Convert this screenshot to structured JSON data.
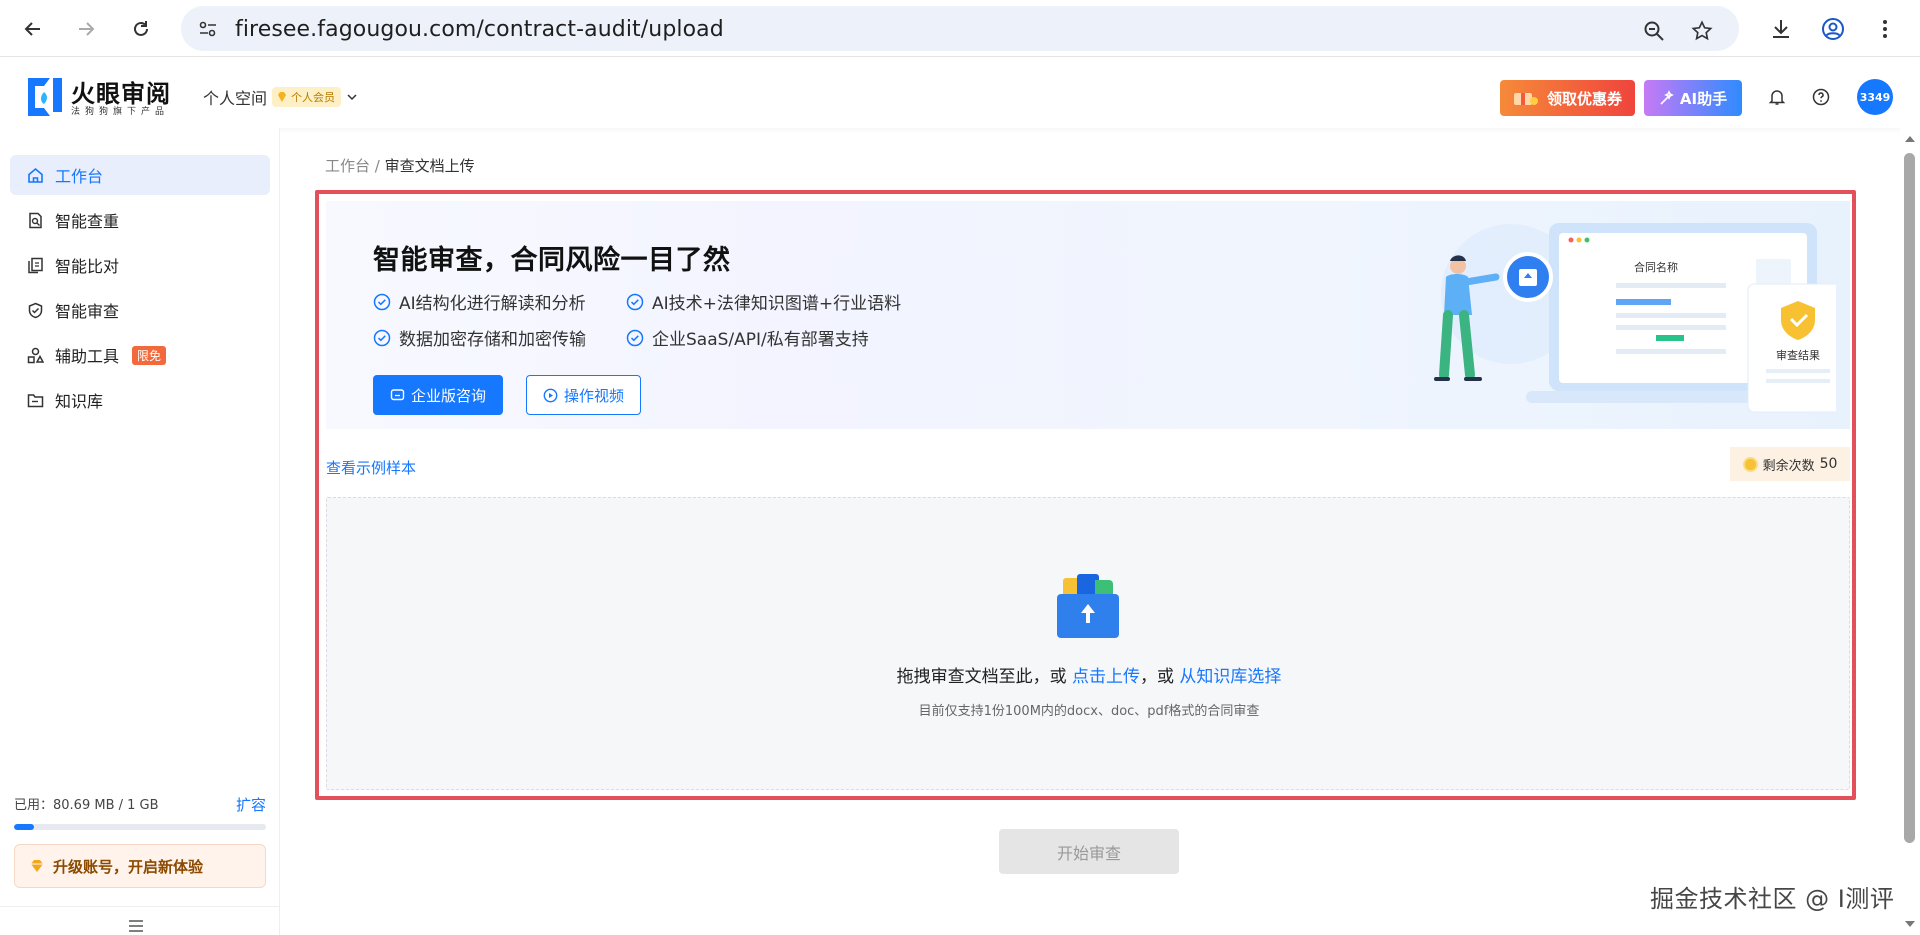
{
  "browser": {
    "url": "firesee.fagougou.com/contract-audit/upload"
  },
  "header": {
    "logo_title": "火眼审阅",
    "logo_sub": "法狗狗旗下产品",
    "space_label": "个人空间",
    "vip_label": "个人会员",
    "coupon_label": "领取优惠券",
    "ai_label": "AI助手",
    "avatar_text": "3349"
  },
  "sidebar": {
    "items": [
      {
        "label": "工作台",
        "icon": "home-icon"
      },
      {
        "label": "智能查重",
        "icon": "doc-search-icon"
      },
      {
        "label": "智能比对",
        "icon": "compare-icon"
      },
      {
        "label": "智能审查",
        "icon": "shield-icon"
      },
      {
        "label": "辅助工具",
        "icon": "tools-icon",
        "tag": "限免"
      },
      {
        "label": "知识库",
        "icon": "folder-icon"
      }
    ],
    "storage_used": "已用：80.69 MB / 1 GB",
    "storage_fraction": 0.079,
    "expand_label": "扩容",
    "upgrade_label": "升级账号，开启新体验"
  },
  "breadcrumb": {
    "root": "工作台",
    "separator": " / ",
    "current": "审查文档上传"
  },
  "banner": {
    "title": "智能审查，合同风险一目了然",
    "features": [
      "AI结构化进行解读和分析",
      "AI技术+法律知识图谱+行业语料",
      "数据加密存储和加密传输",
      "企业SaaS/API/私有部署支持"
    ],
    "consult_label": "企业版咨询",
    "video_label": "操作视频",
    "card_title": "合同名称",
    "result_label": "审查结果"
  },
  "upload": {
    "sample_link": "查看示例样本",
    "remain_label": "剩余次数",
    "remain_count": "50",
    "drop_prefix": "拖拽审查文档至此，或 ",
    "drop_link1": "点击上传",
    "drop_middle": "，或 ",
    "drop_link2": "从知识库选择",
    "hint": "目前仅支持1份100M内的docx、doc、pdf格式的合同审查",
    "start_label": "开始审查"
  },
  "watermark": "掘金技术社区 @ I测评",
  "colors": {
    "primary": "#1677ff",
    "highlight_border": "#e3505a"
  }
}
